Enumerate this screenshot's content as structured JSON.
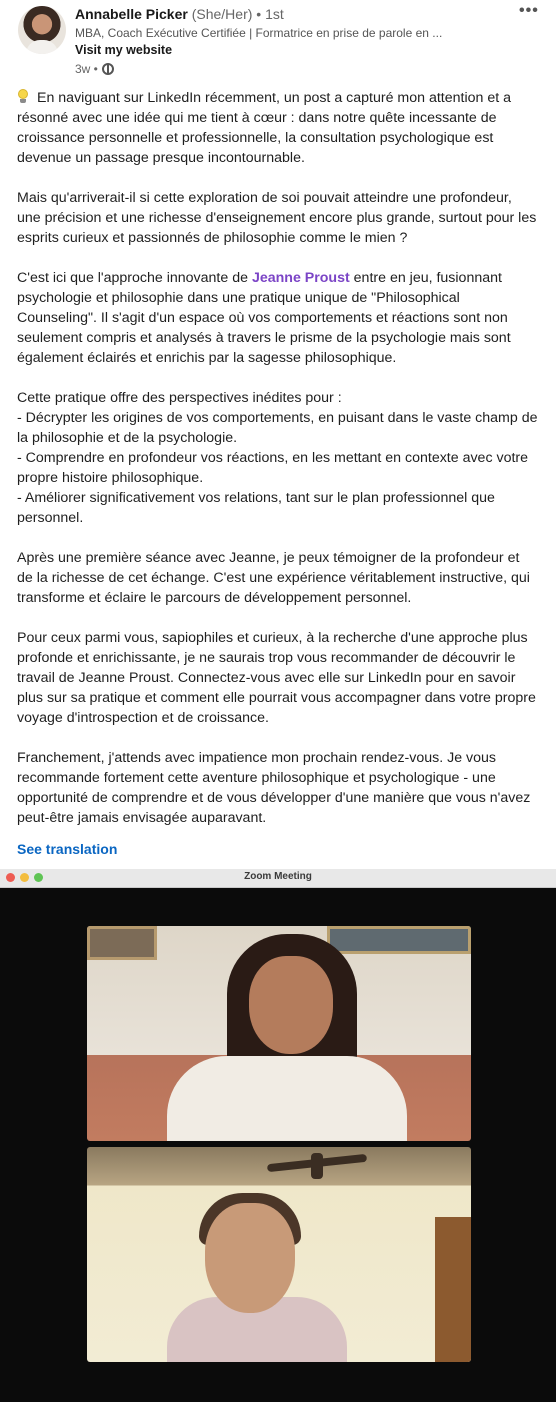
{
  "author": {
    "name": "Annabelle Picker",
    "pronouns": "(She/Her)",
    "degree": "• 1st",
    "headline": "MBA, Coach Exécutive Certifiée | Formatrice en prise de parole en ...",
    "website_link": "Visit my website",
    "time_ago": "3w •",
    "visibility_icon": "globe-icon"
  },
  "menu": {
    "more_label": "•••"
  },
  "post": {
    "p1": "En naviguant sur LinkedIn récemment, un post a capturé mon attention et a résonné avec une idée qui me tient à cœur : dans notre quête incessante de croissance personnelle et professionnelle, la consultation psychologique est devenue un passage presque incontournable.",
    "p2": "Mais qu'arriverait-il si cette exploration de soi pouvait atteindre une profondeur, une précision et une richesse d'enseignement encore plus grande, surtout pour les esprits curieux et passionnés de philosophie comme le mien ?",
    "p3_before": "C'est ici que l'approche innovante de ",
    "p3_mention": "Jeanne Proust",
    "p3_after": " entre en jeu, fusionnant psychologie et philosophie dans une pratique unique de \"Philosophical Counseling\". Il s'agit d'un espace où vos comportements et réactions sont non seulement compris et analysés à travers le prisme de la psychologie mais sont également éclairés et enrichis par la sagesse philosophique.",
    "p4_intro": "Cette pratique offre des perspectives inédites pour :",
    "bullets": [
      "- Décrypter les origines de vos comportements, en puisant dans le vaste champ de la philosophie et de la psychologie.",
      "- Comprendre en profondeur vos réactions, en les mettant en contexte avec votre propre histoire philosophique.",
      "- Améliorer significativement vos relations, tant sur le plan professionnel que personnel."
    ],
    "p5": "Après une première séance avec Jeanne, je peux témoigner de la profondeur et de la richesse de cet échange. C'est une expérience véritablement instructive, qui transforme et éclaire le parcours de développement personnel.",
    "p6": "Pour ceux parmi vous, sapiophiles et curieux, à la recherche d'une approche plus profonde et enrichissante, je ne saurais trop vous recommander de découvrir le travail de Jeanne Proust. Connectez-vous avec elle sur LinkedIn pour en savoir plus sur sa pratique et comment elle pourrait vous accompagner dans votre propre voyage d'introspection et de croissance.",
    "p7": "Franchement, j'attends avec impatience mon prochain rendez-vous. Je vous recommande fortement cette aventure philosophique et psychologique - une opportunité de comprendre et de vous développer d'une manière que vous n'avez peut-être jamais envisagée auparavant.",
    "see_translation": "See translation"
  },
  "zoom": {
    "window_title": "Zoom Meeting"
  },
  "colors": {
    "link_blue": "#0a66c2",
    "mention_purple": "#7b44c6"
  }
}
